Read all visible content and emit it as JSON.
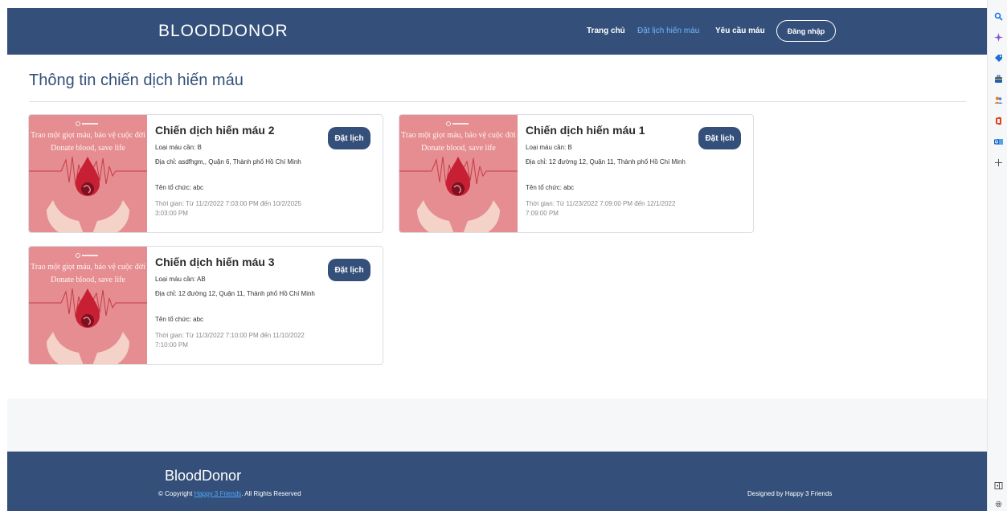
{
  "nav": {
    "brand": "BLOODDONOR",
    "links": [
      {
        "label": "Trang chủ"
      },
      {
        "label": "Đặt lịch hiến máu"
      },
      {
        "label": "Yêu cầu máu"
      }
    ],
    "login": "Đăng nhập"
  },
  "main": {
    "title": "Thông tin chiến dịch hiến máu",
    "image_text_line1": "Trao một giọt máu, bảo vệ cuộc đời",
    "image_text_line2": "Donate blood, save life",
    "book_label": "Đặt lịch",
    "campaigns": [
      {
        "title": "Chiến dịch hiến máu 2",
        "blood_type": "Loại máu cần: B",
        "address": "Địa chỉ: asdfhgm,, Quận 6, Thành phố Hồ Chí Minh",
        "organizer": "Tên tổ chức: abc",
        "time": "Thời gian: Từ 11/2/2022 7:03:00 PM đến 10/2/2025 3:03:00 PM"
      },
      {
        "title": "Chiến dịch hiến máu 1",
        "blood_type": "Loại máu cần: B",
        "address": "Địa chỉ: 12 đường 12, Quận 11, Thành phố Hồ Chí Minh",
        "organizer": "Tên tổ chức: abc",
        "time": "Thời gian: Từ 11/23/2022 7:09:00 PM đến 12/1/2022 7:09:00 PM"
      },
      {
        "title": "Chiến dịch hiến máu 3",
        "blood_type": "Loại máu cần: AB",
        "address": "Địa chỉ: 12 đường 12, Quận 11, Thành phố Hồ Chí Minh",
        "organizer": "Tên tổ chức: abc",
        "time": "Thời gian: Từ 11/3/2022 7:10:00 PM đến 11/10/2022 7:10:00 PM"
      }
    ]
  },
  "footer": {
    "brand": "BloodDonor",
    "copy_prefix": "© Copyright ",
    "copy_link": "Happy 3 Friends",
    "copy_suffix": ". All Rights Reserved",
    "designed_by": "Designed by Happy 3 Friends"
  },
  "colors": {
    "navy": "#34507a",
    "active_link": "#6fb6ff",
    "card_image_bg": "#e58d91"
  },
  "gutter_icons": [
    "search-icon",
    "sparkle-icon",
    "tag-icon",
    "briefcase-icon",
    "people-icon",
    "office-icon",
    "outlook-icon",
    "plus-icon",
    "sidebar-toggle-icon",
    "settings-icon"
  ]
}
